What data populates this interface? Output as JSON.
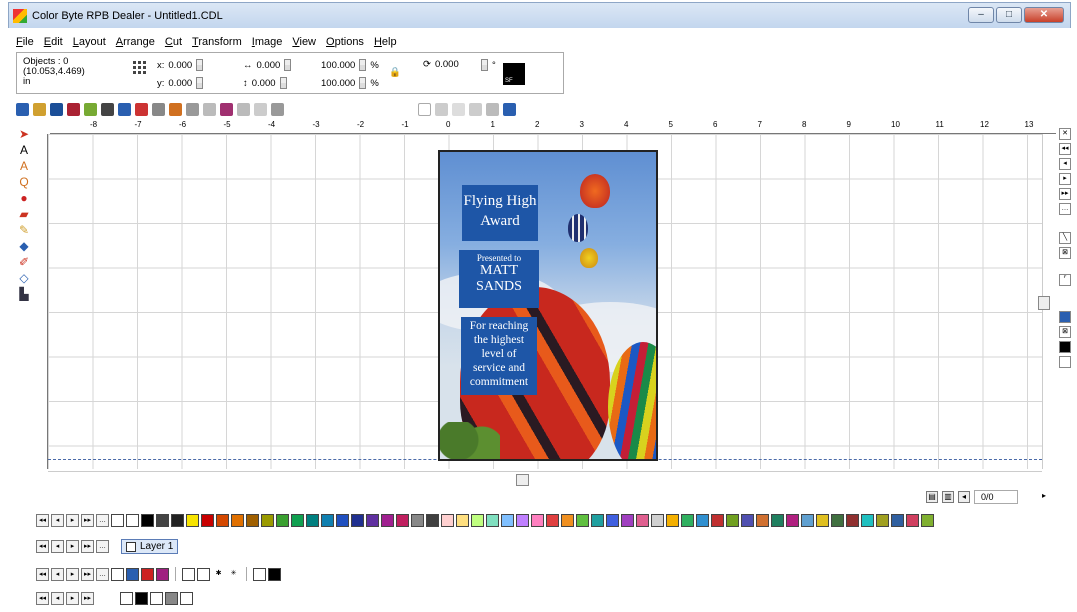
{
  "window": {
    "title": "Color Byte RPB Dealer - Untitled1.CDL",
    "minimize": "–",
    "maximize": "□",
    "close": "✕"
  },
  "menu": [
    {
      "label": "File",
      "u": "F",
      "rest": "ile"
    },
    {
      "label": "Edit",
      "u": "E",
      "rest": "dit"
    },
    {
      "label": "Layout",
      "u": "L",
      "rest": "ayout"
    },
    {
      "label": "Arrange",
      "u": "A",
      "rest": "rrange"
    },
    {
      "label": "Cut",
      "u": "C",
      "rest": "ut"
    },
    {
      "label": "Transform",
      "u": "T",
      "rest": "ransform"
    },
    {
      "label": "Image",
      "u": "I",
      "rest": "mage"
    },
    {
      "label": "View",
      "u": "V",
      "rest": "iew"
    },
    {
      "label": "Options",
      "u": "O",
      "rest": "ptions"
    },
    {
      "label": "Help",
      "u": "H",
      "rest": "elp"
    }
  ],
  "properties": {
    "objects": "Objects : 0",
    "coords": "(10.053,4.469)",
    "units": "in",
    "x_label": "x:",
    "x_value": "0.000",
    "y_label": "y:",
    "y_value": "0.000",
    "w_value": "0.000",
    "h_value": "0.000",
    "scale_x": "100.000",
    "scale_y": "100.000",
    "pct": "%",
    "rotate_value": "0.000",
    "degree": "°",
    "sf_label": "SF"
  },
  "ruler": {
    "labels": [
      "-8",
      "-7",
      "-6",
      "-5",
      "-4",
      "-3",
      "-2",
      "-1",
      "0",
      "1",
      "2",
      "3",
      "4",
      "5",
      "6",
      "7",
      "8",
      "9",
      "10",
      "11",
      "12",
      "13"
    ]
  },
  "award": {
    "title_line1": "Flying High",
    "title_line2": "Award",
    "presented": "Presented to",
    "name_line1": "MATT",
    "name_line2": "SANDS",
    "body": [
      "For reaching",
      "the highest",
      "level of",
      "service and",
      "commitment"
    ]
  },
  "page_nav": {
    "count": "0/0"
  },
  "layers": {
    "current": "Layer 1"
  },
  "palette": [
    "#f7e400",
    "#c80000",
    "#d44800",
    "#e07000",
    "#a06000",
    "#9a9a00",
    "#3aa030",
    "#10a050",
    "#008080",
    "#1080b0",
    "#2050c0",
    "#203090",
    "#6030a0",
    "#a02090",
    "#c02060",
    "#888888",
    "#404040",
    "#ffd0d0",
    "#ffe080",
    "#c0ff80",
    "#80e0c0",
    "#80c0ff",
    "#c080ff",
    "#ff80c0",
    "#e04040",
    "#f09020",
    "#60c040",
    "#20a0a0",
    "#4060e0",
    "#a040c0",
    "#e06090",
    "#d0d0d0",
    "#f4b000",
    "#30b060",
    "#3090d0",
    "#c03030",
    "#70a020",
    "#5050b0",
    "#d07030",
    "#208060",
    "#b02080",
    "#60a0d0",
    "#e0c020",
    "#407040",
    "#903030",
    "#20c0c0",
    "#a0a020",
    "#3060a0",
    "#d04060",
    "#80b030"
  ]
}
